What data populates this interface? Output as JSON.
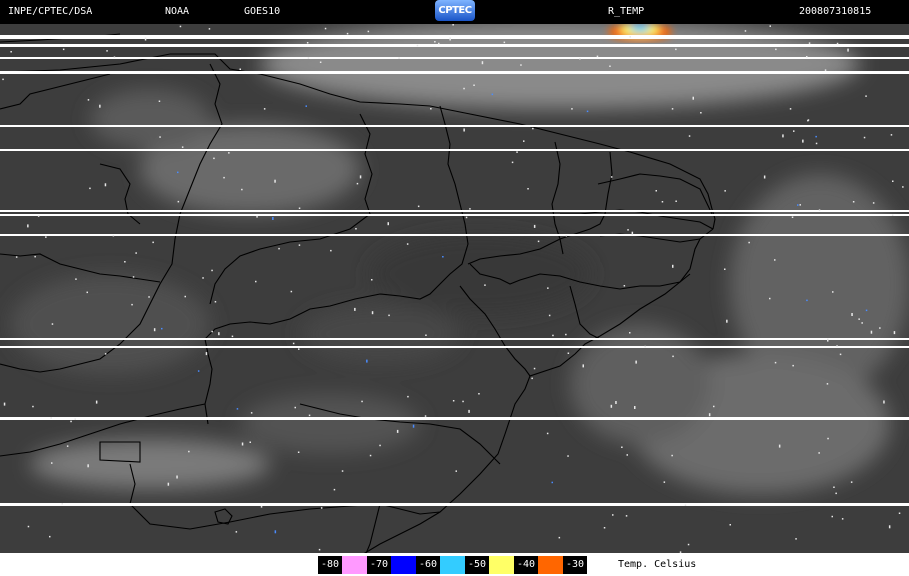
{
  "header": {
    "agency": "INPE/CPTEC/DSA",
    "source": "NOAA",
    "satellite": "GOES10",
    "logo_text": "CPTEC",
    "product": "R_TEMP",
    "datetime": "200807310815"
  },
  "legend": {
    "items": [
      {
        "label": "-80",
        "color": "#ff99ff"
      },
      {
        "label": "-70",
        "color": "#0000ff"
      },
      {
        "label": "-60",
        "color": "#33ccff"
      },
      {
        "label": "-50",
        "color": "#ffff66"
      },
      {
        "label": "-40",
        "color": "#ff6600"
      },
      {
        "label": "-30",
        "color": "#ffffff"
      }
    ],
    "title": "Temp. Celsius"
  },
  "colors": {
    "header_bg": "#000000",
    "map_bg": "#3d3d3d",
    "boundaries": "#000000",
    "scanline_gaps": "#ffffff"
  }
}
